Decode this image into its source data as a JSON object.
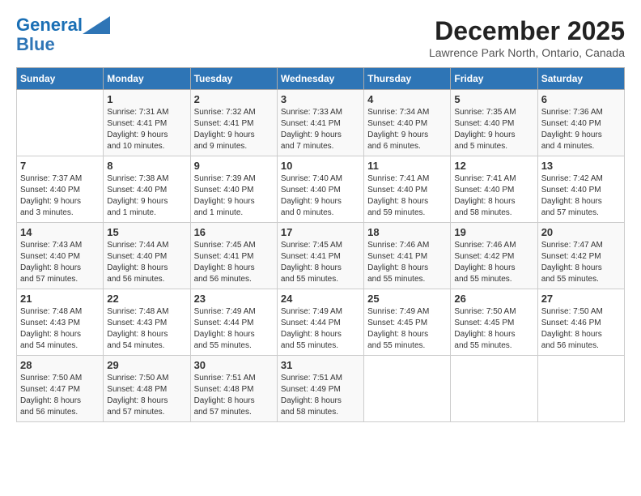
{
  "header": {
    "logo_line1": "General",
    "logo_line2": "Blue",
    "month": "December 2025",
    "location": "Lawrence Park North, Ontario, Canada"
  },
  "weekdays": [
    "Sunday",
    "Monday",
    "Tuesday",
    "Wednesday",
    "Thursday",
    "Friday",
    "Saturday"
  ],
  "weeks": [
    [
      {
        "day": "",
        "info": ""
      },
      {
        "day": "1",
        "info": "Sunrise: 7:31 AM\nSunset: 4:41 PM\nDaylight: 9 hours\nand 10 minutes."
      },
      {
        "day": "2",
        "info": "Sunrise: 7:32 AM\nSunset: 4:41 PM\nDaylight: 9 hours\nand 9 minutes."
      },
      {
        "day": "3",
        "info": "Sunrise: 7:33 AM\nSunset: 4:41 PM\nDaylight: 9 hours\nand 7 minutes."
      },
      {
        "day": "4",
        "info": "Sunrise: 7:34 AM\nSunset: 4:40 PM\nDaylight: 9 hours\nand 6 minutes."
      },
      {
        "day": "5",
        "info": "Sunrise: 7:35 AM\nSunset: 4:40 PM\nDaylight: 9 hours\nand 5 minutes."
      },
      {
        "day": "6",
        "info": "Sunrise: 7:36 AM\nSunset: 4:40 PM\nDaylight: 9 hours\nand 4 minutes."
      }
    ],
    [
      {
        "day": "7",
        "info": "Sunrise: 7:37 AM\nSunset: 4:40 PM\nDaylight: 9 hours\nand 3 minutes."
      },
      {
        "day": "8",
        "info": "Sunrise: 7:38 AM\nSunset: 4:40 PM\nDaylight: 9 hours\nand 1 minute."
      },
      {
        "day": "9",
        "info": "Sunrise: 7:39 AM\nSunset: 4:40 PM\nDaylight: 9 hours\nand 1 minute."
      },
      {
        "day": "10",
        "info": "Sunrise: 7:40 AM\nSunset: 4:40 PM\nDaylight: 9 hours\nand 0 minutes."
      },
      {
        "day": "11",
        "info": "Sunrise: 7:41 AM\nSunset: 4:40 PM\nDaylight: 8 hours\nand 59 minutes."
      },
      {
        "day": "12",
        "info": "Sunrise: 7:41 AM\nSunset: 4:40 PM\nDaylight: 8 hours\nand 58 minutes."
      },
      {
        "day": "13",
        "info": "Sunrise: 7:42 AM\nSunset: 4:40 PM\nDaylight: 8 hours\nand 57 minutes."
      }
    ],
    [
      {
        "day": "14",
        "info": "Sunrise: 7:43 AM\nSunset: 4:40 PM\nDaylight: 8 hours\nand 57 minutes."
      },
      {
        "day": "15",
        "info": "Sunrise: 7:44 AM\nSunset: 4:40 PM\nDaylight: 8 hours\nand 56 minutes."
      },
      {
        "day": "16",
        "info": "Sunrise: 7:45 AM\nSunset: 4:41 PM\nDaylight: 8 hours\nand 56 minutes."
      },
      {
        "day": "17",
        "info": "Sunrise: 7:45 AM\nSunset: 4:41 PM\nDaylight: 8 hours\nand 55 minutes."
      },
      {
        "day": "18",
        "info": "Sunrise: 7:46 AM\nSunset: 4:41 PM\nDaylight: 8 hours\nand 55 minutes."
      },
      {
        "day": "19",
        "info": "Sunrise: 7:46 AM\nSunset: 4:42 PM\nDaylight: 8 hours\nand 55 minutes."
      },
      {
        "day": "20",
        "info": "Sunrise: 7:47 AM\nSunset: 4:42 PM\nDaylight: 8 hours\nand 55 minutes."
      }
    ],
    [
      {
        "day": "21",
        "info": "Sunrise: 7:48 AM\nSunset: 4:43 PM\nDaylight: 8 hours\nand 54 minutes."
      },
      {
        "day": "22",
        "info": "Sunrise: 7:48 AM\nSunset: 4:43 PM\nDaylight: 8 hours\nand 54 minutes."
      },
      {
        "day": "23",
        "info": "Sunrise: 7:49 AM\nSunset: 4:44 PM\nDaylight: 8 hours\nand 55 minutes."
      },
      {
        "day": "24",
        "info": "Sunrise: 7:49 AM\nSunset: 4:44 PM\nDaylight: 8 hours\nand 55 minutes."
      },
      {
        "day": "25",
        "info": "Sunrise: 7:49 AM\nSunset: 4:45 PM\nDaylight: 8 hours\nand 55 minutes."
      },
      {
        "day": "26",
        "info": "Sunrise: 7:50 AM\nSunset: 4:45 PM\nDaylight: 8 hours\nand 55 minutes."
      },
      {
        "day": "27",
        "info": "Sunrise: 7:50 AM\nSunset: 4:46 PM\nDaylight: 8 hours\nand 56 minutes."
      }
    ],
    [
      {
        "day": "28",
        "info": "Sunrise: 7:50 AM\nSunset: 4:47 PM\nDaylight: 8 hours\nand 56 minutes."
      },
      {
        "day": "29",
        "info": "Sunrise: 7:50 AM\nSunset: 4:48 PM\nDaylight: 8 hours\nand 57 minutes."
      },
      {
        "day": "30",
        "info": "Sunrise: 7:51 AM\nSunset: 4:48 PM\nDaylight: 8 hours\nand 57 minutes."
      },
      {
        "day": "31",
        "info": "Sunrise: 7:51 AM\nSunset: 4:49 PM\nDaylight: 8 hours\nand 58 minutes."
      },
      {
        "day": "",
        "info": ""
      },
      {
        "day": "",
        "info": ""
      },
      {
        "day": "",
        "info": ""
      }
    ]
  ]
}
